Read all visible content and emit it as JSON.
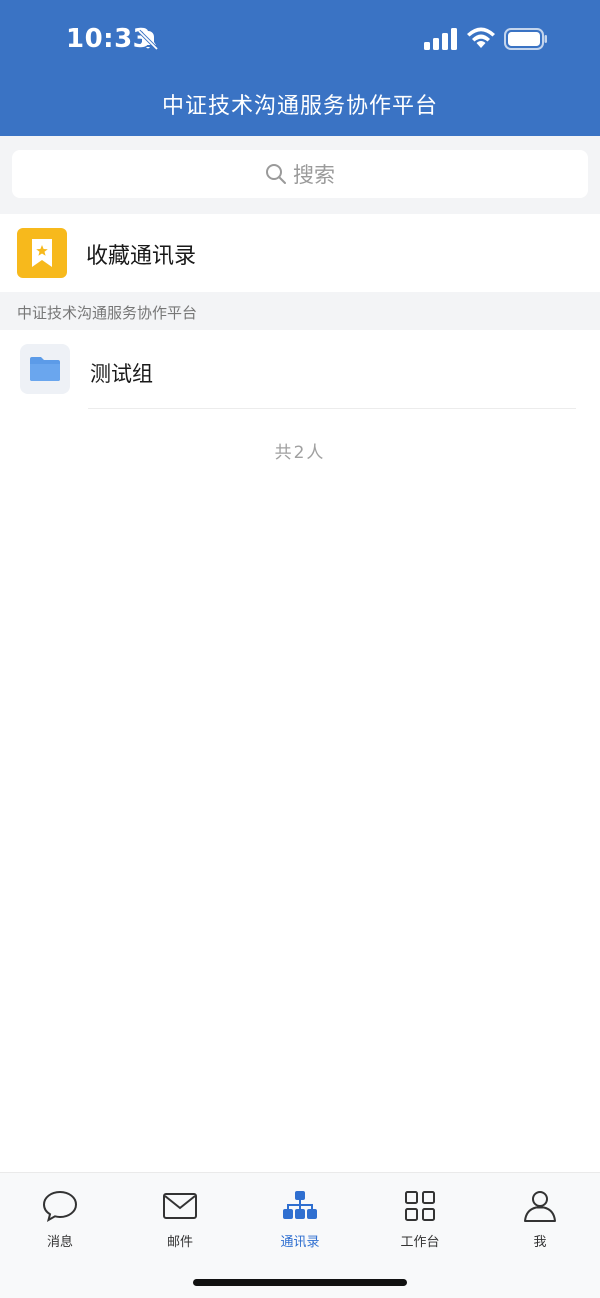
{
  "status_bar": {
    "time": "10:33",
    "icons": [
      "bell-muted-icon",
      "signal-icon",
      "wifi-icon",
      "battery-icon"
    ]
  },
  "header": {
    "title": "中证技术沟通服务协作平台",
    "background": "#3a73c4"
  },
  "search": {
    "placeholder": "搜索",
    "icon": "search-icon"
  },
  "favorites": {
    "label": "收藏通讯录",
    "icon": "bookmark-star-icon",
    "icon_color": "#f7b91c"
  },
  "section": {
    "title": "中证技术沟通服务协作平台"
  },
  "groups": [
    {
      "label": "测试组",
      "icon": "folder-icon"
    }
  ],
  "member_count": "共2人",
  "tabbar": {
    "active_color": "#2f6fd0",
    "items": [
      {
        "label": "消息",
        "icon": "chat-bubble-icon",
        "active": false
      },
      {
        "label": "邮件",
        "icon": "mail-icon",
        "active": false
      },
      {
        "label": "通讯录",
        "icon": "org-chart-icon",
        "active": true
      },
      {
        "label": "工作台",
        "icon": "grid-icon",
        "active": false
      },
      {
        "label": "我",
        "icon": "person-icon",
        "active": false
      }
    ]
  }
}
